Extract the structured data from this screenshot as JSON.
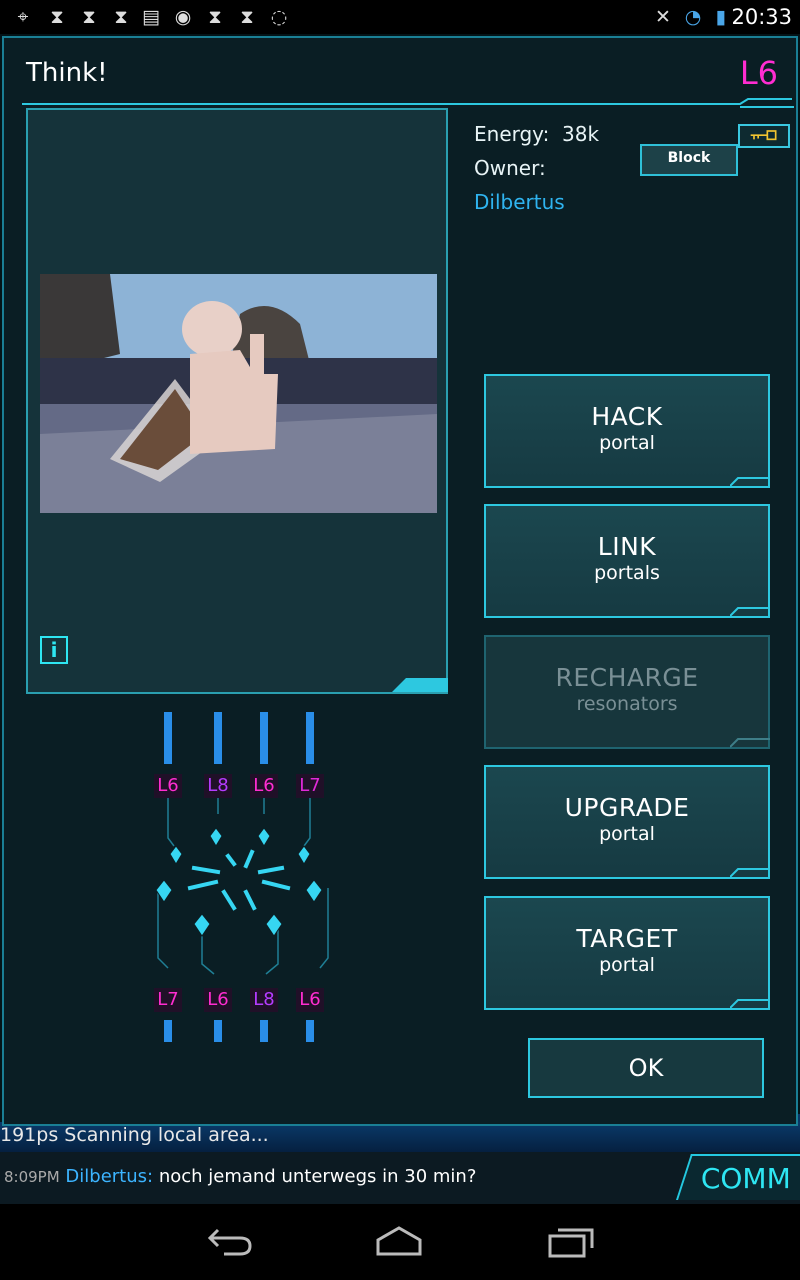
{
  "status_bar": {
    "time": "20:33",
    "icons": [
      "gps-icon",
      "hourglass-icon",
      "hourglass-icon",
      "hourglass-icon",
      "chat-icon",
      "ingress-icon",
      "hourglass-icon",
      "hourglass-icon",
      "signal-off-icon",
      "mute-icon",
      "wifi-icon",
      "battery-icon"
    ]
  },
  "portal": {
    "title": "Think!",
    "level": "L6",
    "energy_label": "Energy:",
    "energy_value": "38k",
    "owner_label": "Owner:",
    "owner_name": "Dilbertus",
    "block_label": "Block",
    "info_label": "i"
  },
  "actions": [
    {
      "label": "HACK",
      "sub": "portal",
      "enabled": true
    },
    {
      "label": "LINK",
      "sub": "portals",
      "enabled": true
    },
    {
      "label": "RECHARGE",
      "sub": "resonators",
      "enabled": false
    },
    {
      "label": "UPGRADE",
      "sub": "portal",
      "enabled": true
    },
    {
      "label": "TARGET",
      "sub": "portal",
      "enabled": true
    }
  ],
  "ok_label": "OK",
  "resonators": {
    "top": [
      "L6",
      "L8",
      "L6",
      "L7"
    ],
    "bottom": [
      "L7",
      "L6",
      "L8",
      "L6"
    ]
  },
  "feed": {
    "scan_text": "191ps  Scanning local area...",
    "chat_time": "8:09PM",
    "chat_user": "Dilbertus:",
    "chat_message": "noch jemand unterwegs in 30 min?",
    "comm_label": "COMM"
  },
  "colors": {
    "accent": "#2dc8e0",
    "level_magenta": "#ff2dd1",
    "level_purple": "#b53cff",
    "owner_blue": "#2fb4f0"
  }
}
